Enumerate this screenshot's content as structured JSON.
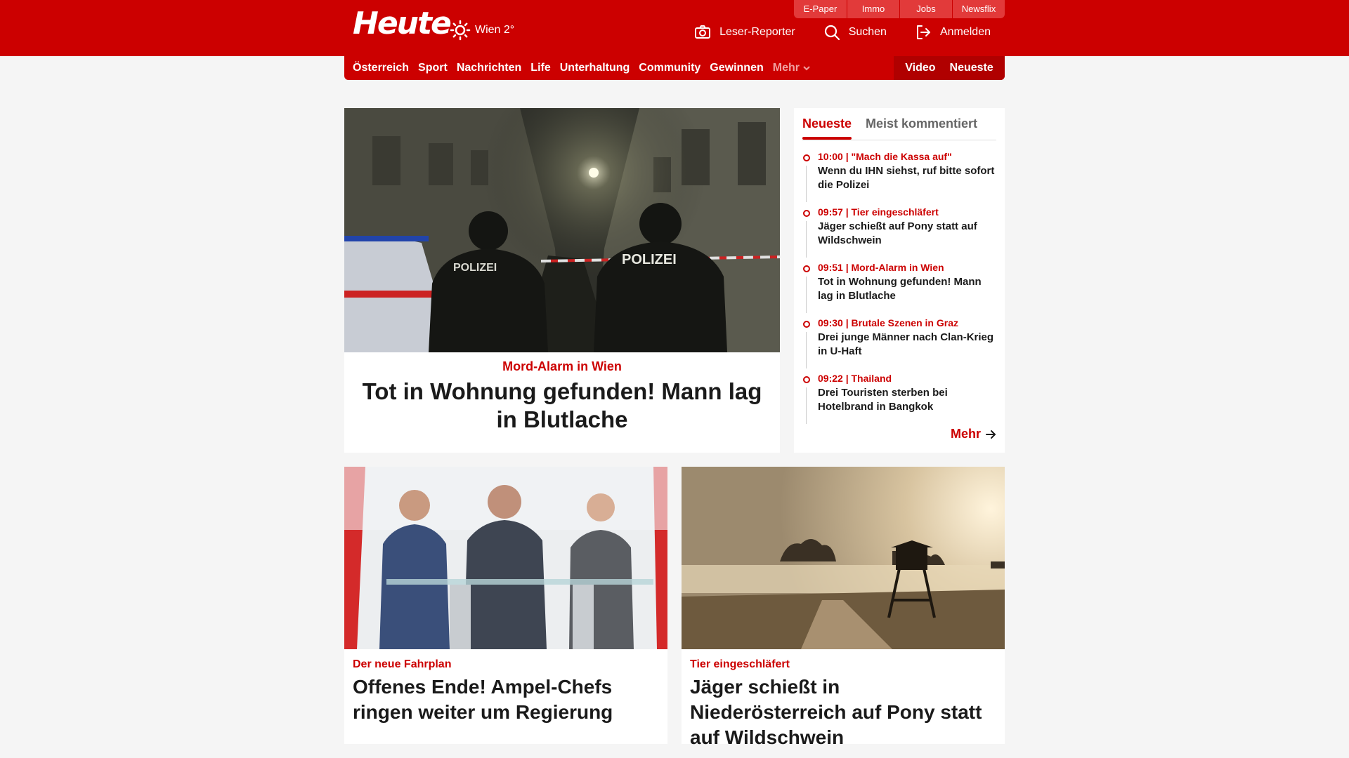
{
  "header": {
    "logo": "Heute",
    "weather": {
      "location": "Wien 2°",
      "icon": "sun-icon"
    },
    "top_links": [
      "E-Paper",
      "Immo",
      "Jobs",
      "Newsflix"
    ],
    "actions": {
      "reporter": "Leser-Reporter",
      "search": "Suchen",
      "login": "Anmelden"
    },
    "brand_color": "#cc0000"
  },
  "nav": {
    "items": [
      "Österreich",
      "Sport",
      "Nachrichten",
      "Life",
      "Unterhaltung",
      "Community",
      "Gewinnen"
    ],
    "more": "Mehr",
    "video": "Video",
    "latest": "Neueste"
  },
  "hero": {
    "kicker": "Mord-Alarm in Wien",
    "title": "Tot in Wohnung gefunden! Mann lag in Blutlache",
    "image_labels": [
      "POLIZEI",
      "POLIZEI"
    ]
  },
  "sidebar": {
    "tabs": [
      "Neueste",
      "Meist kommentiert"
    ],
    "items": [
      {
        "meta": "10:00 | \"Mach die Kassa auf\"",
        "title": "Wenn du IHN siehst, ruf bitte sofort die Polizei"
      },
      {
        "meta": "09:57 | Tier eingeschläfert",
        "title": "Jäger schießt auf Pony statt auf Wildschwein"
      },
      {
        "meta": "09:51 | Mord-Alarm in Wien",
        "title": "Tot in Wohnung gefunden! Mann lag in Blutlache"
      },
      {
        "meta": "09:30 | Brutale Szenen in Graz",
        "title": "Drei junge Männer nach Clan-Krieg in U-Haft"
      },
      {
        "meta": "09:22 | Thailand",
        "title": "Drei Touristen sterben bei Hotelbrand in Bangkok"
      }
    ],
    "more": "Mehr"
  },
  "cards": [
    {
      "kicker": "Der neue Fahrplan",
      "title": "Offenes Ende! Ampel-Chefs ringen weiter um Regierung"
    },
    {
      "kicker": "Tier eingeschläfert",
      "title": "Jäger schießt in Niederösterreich auf Pony statt auf Wildschwein"
    }
  ]
}
